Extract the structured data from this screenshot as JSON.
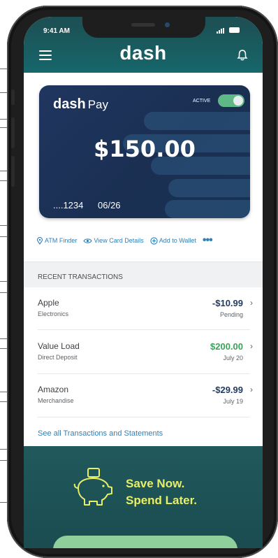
{
  "status_bar": {
    "time": "9:41 AM"
  },
  "header": {
    "brand": "dash"
  },
  "card": {
    "brand_main": "dash",
    "brand_sub": "Pay",
    "status_label": "ACTIVE",
    "balance": "$150.00",
    "last4": "....1234",
    "expiry": "06/26"
  },
  "actions": [
    {
      "label": "ATM Finder",
      "icon": "location-pin-icon"
    },
    {
      "label": "View Card Details",
      "icon": "eye-icon"
    },
    {
      "label": "Add to Wallet",
      "icon": "plus-circle-icon"
    }
  ],
  "actions_more": "•••",
  "transactions": {
    "heading": "RECENT TRANSACTIONS",
    "items": [
      {
        "name": "Apple",
        "category": "Electronics",
        "amount": "-$10.99",
        "status": "Pending",
        "amount_color": "#1f3b5f"
      },
      {
        "name": "Value Load",
        "category": "Direct Deposit",
        "amount": "$200.00",
        "status": "July 20",
        "amount_color": "#3aa35a"
      },
      {
        "name": "Amazon",
        "category": "Merchandise",
        "amount": "-$29.99",
        "status": "July 19",
        "amount_color": "#1f3b5f"
      }
    ],
    "chevron": "›",
    "see_all": "See all Transactions and Statements"
  },
  "promo": {
    "line1": "Save Now.",
    "line2": "Spend Later.",
    "icon": "piggy-bank-icon"
  },
  "colors": {
    "header": "#1a5c60",
    "card": "#1c3257",
    "accent_green": "#3aa35a",
    "link_blue": "#2f7fb8",
    "promo_text": "#e7ef6a"
  }
}
